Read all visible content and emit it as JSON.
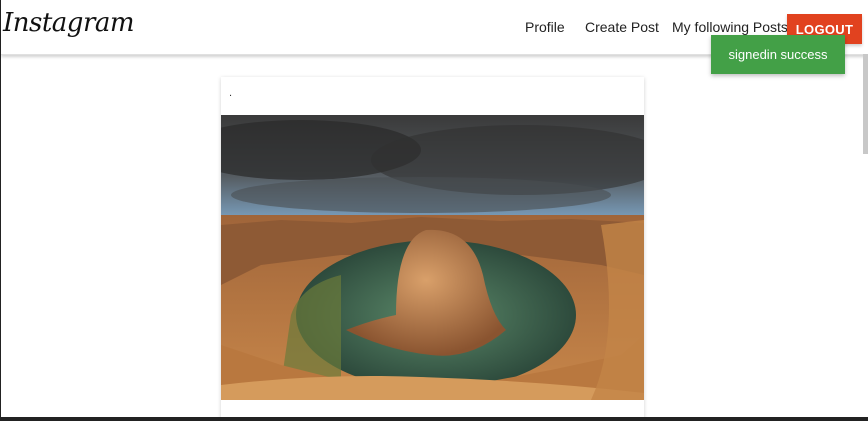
{
  "navbar": {
    "brand": "Instagram",
    "links": [
      {
        "label": "Profile"
      },
      {
        "label": "Create Post"
      },
      {
        "label": "My following Posts"
      }
    ],
    "logout_label": "LOGOUT",
    "logout_color": "#e1421f"
  },
  "toast": {
    "message": "signedin success",
    "color": "#43a047"
  },
  "post": {
    "image_alt": "canyon-river-bend-photo"
  }
}
